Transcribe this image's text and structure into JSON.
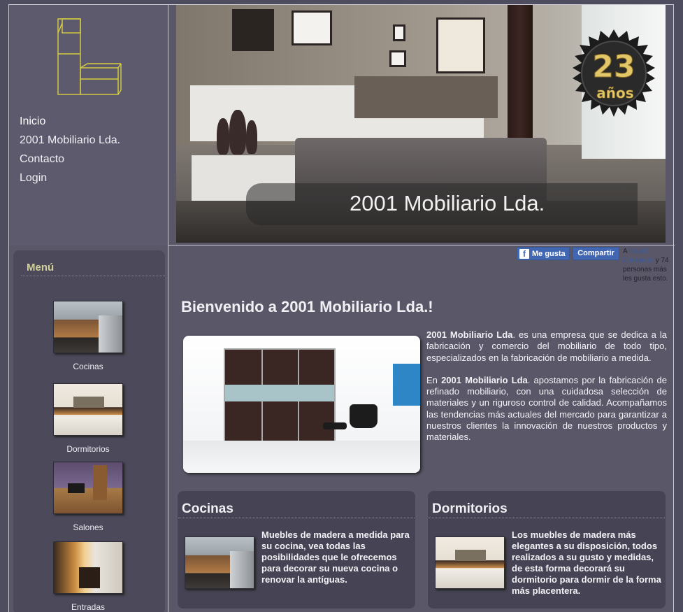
{
  "nav": {
    "items": [
      {
        "label": "Inicio"
      },
      {
        "label": "2001 Mobiliario Lda."
      },
      {
        "label": "Contacto"
      },
      {
        "label": "Login"
      }
    ]
  },
  "hero": {
    "title": "2001 Mobiliario Lda.",
    "badge_number": "23",
    "badge_label": "años"
  },
  "menu": {
    "title": "Menú",
    "items": [
      {
        "label": "Cocinas"
      },
      {
        "label": "Dormitorios"
      },
      {
        "label": "Salones"
      },
      {
        "label": "Entradas"
      }
    ]
  },
  "social": {
    "like_label": "Me gusta",
    "share_label": "Compartir",
    "count_prefix": "A",
    "count_name": "David Camarate",
    "count_middle": "y 74",
    "count_suffix": "personas más les gusta esto."
  },
  "welcome": {
    "title": "Bienvenido a 2001 Mobiliario Lda.!",
    "p1_brand": "2001 Mobiliario Lda",
    "p1_rest": ". es una empresa que se dedica a la fabricación y comercio del mobiliario de todo tipo, especializados en la fabricación de mobiliario a medida.",
    "p2_start": "En",
    "p2_brand": "2001 Mobiliario Lda",
    "p2_rest": ". apostamos por la fabricación de refinado mobiliario, con una cuidadosa selección de materiales y un riguroso control de calidad. Acompañamos las tendencias más actuales del mercado para garantizar a nuestros clientes la innovación de nuestros productos y materiales."
  },
  "features": [
    {
      "title": "Cocinas",
      "text": "Muebles de madera a medida para su cocina, vea todas las posibilidades que le ofrecemos para decorar su nueva cocina o renovar la antíguas."
    },
    {
      "title": "Dormitorios",
      "text": "Los muebles de madera más elegantes a su disposición, todos realizados a su gusto y medidas, de esta forma decorará su dormitorio para dormir de la forma más placentera."
    }
  ],
  "colors": {
    "background": "#4e4c5f",
    "menu_title": "#d4d09a",
    "logo": "#d8d040",
    "facebook": "#4267b2"
  }
}
